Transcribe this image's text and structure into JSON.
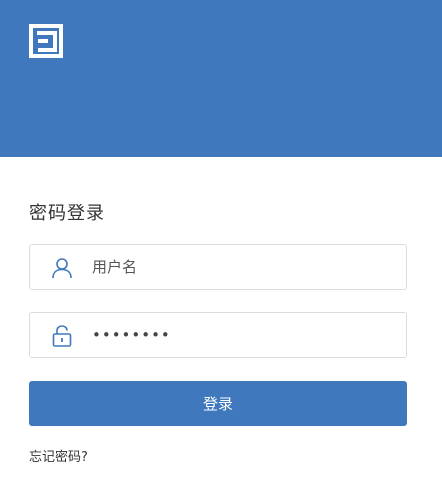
{
  "banner": {
    "logo_icon": "brand-logo-icon",
    "blurred_text": "",
    "color": "#3f78bd"
  },
  "form": {
    "title": "密码登录",
    "username": {
      "icon": "user-icon",
      "placeholder": "用户名",
      "value": ""
    },
    "password": {
      "icon": "lock-icon",
      "value": "••••••••"
    },
    "login_label": "登录",
    "forgot_label": "忘记密码?"
  }
}
